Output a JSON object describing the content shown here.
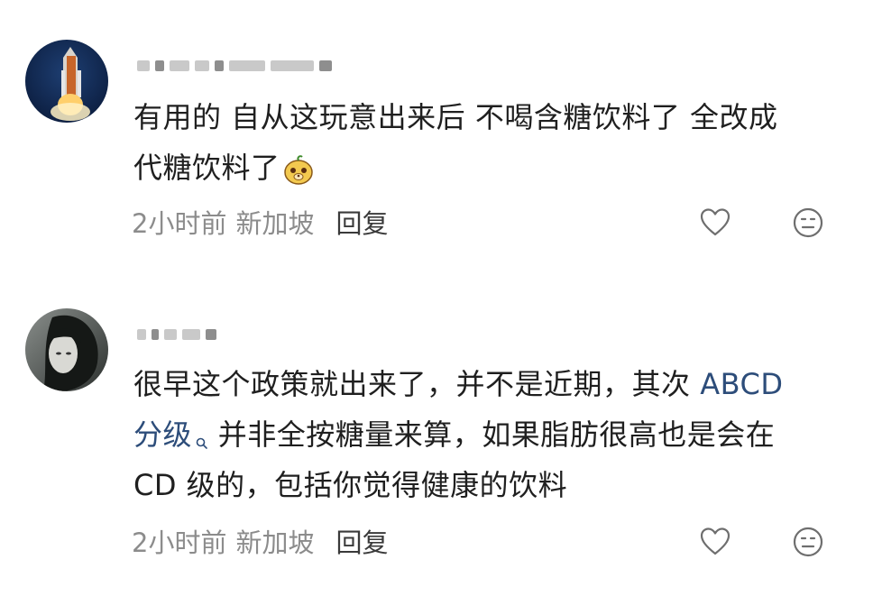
{
  "comments": [
    {
      "text_line1": "有用的 自从这玩意出来后 不喝含糖饮料了 全改成",
      "text_line2": "代糖饮料了",
      "time": "2小时前",
      "location": "新加坡",
      "reply_label": "回复",
      "emoji_icon": "cute-face-emoji"
    },
    {
      "text_line1_a": "很早这个政策就出来了，并不是近期，其次 ",
      "link_a": "ABCD",
      "link_b": "分级",
      "text_line2_b": " 并非全按糖量来算，如果脂肪很高也是会在",
      "text_line3": "CD 级的，包括你觉得健康的饮料",
      "time": "2小时前",
      "location": "新加坡",
      "reply_label": "回复"
    }
  ],
  "colors": {
    "link": "#2d4d7a",
    "meta": "#8c8c8c",
    "text": "#1f1f1f"
  }
}
